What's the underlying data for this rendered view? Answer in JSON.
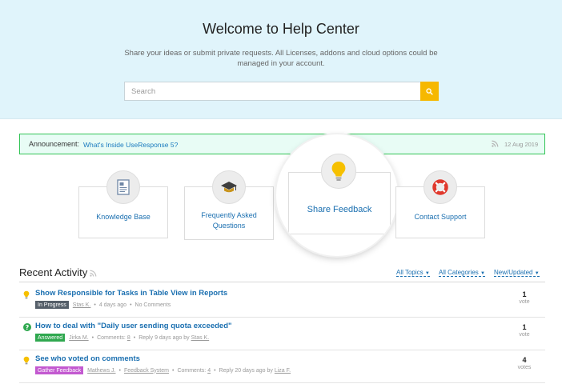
{
  "hero": {
    "title": "Welcome to Help Center",
    "subtitle": "Share your ideas or submit private requests. All Licenses, addons and cloud options could be managed in your account.",
    "search_placeholder": "Search"
  },
  "announcement": {
    "label": "Announcement:",
    "link_text": "What's Inside UseResponse 5?",
    "date": "12 Aug 2019"
  },
  "cards": {
    "knowledge_base": "Knowledge Base",
    "faq": "Frequently Asked Questions",
    "share_feedback": "Share Feedback",
    "contact_support": "Contact Support"
  },
  "recent": {
    "title": "Recent Activity",
    "filters": {
      "topics": "All Topics",
      "categories": "All Categories",
      "sort": "New/Updated"
    }
  },
  "items": [
    {
      "title": "Show Responsible for Tasks in Table View in Reports",
      "status": "In Progress",
      "status_color": "#555f69",
      "author": "Stas K.",
      "time": "4 days ago",
      "comments": "No Comments",
      "votes": "1",
      "votes_label": "vote",
      "icon": "lightbulb-icon"
    },
    {
      "title": "How to deal with \"Daily user sending quota exceeded\"",
      "status": "Answered",
      "status_color": "#2fa84f",
      "author": "Jirka M.",
      "comments_label": "Comments:",
      "comments_count": "8",
      "reply_text": "Reply",
      "reply_time": "9 days ago by",
      "reply_author": "Stas K.",
      "votes": "1",
      "votes_label": "vote",
      "icon": "question-icon"
    },
    {
      "title": "See who voted on comments",
      "status": "Gather Feedback",
      "status_color": "#c359d0",
      "author": "Mathews J.",
      "category": "Feedback System",
      "comments_label": "Comments:",
      "comments_count": "4",
      "reply_text": "Reply",
      "reply_time": "20 days ago by",
      "reply_author": "Liza F.",
      "votes": "4",
      "votes_label": "votes",
      "icon": "lightbulb-icon"
    }
  ],
  "colors": {
    "accent": "#f6b800",
    "link": "#1a6fb0",
    "announce_border": "#33c456",
    "hero_bg": "#e0f4fb"
  }
}
